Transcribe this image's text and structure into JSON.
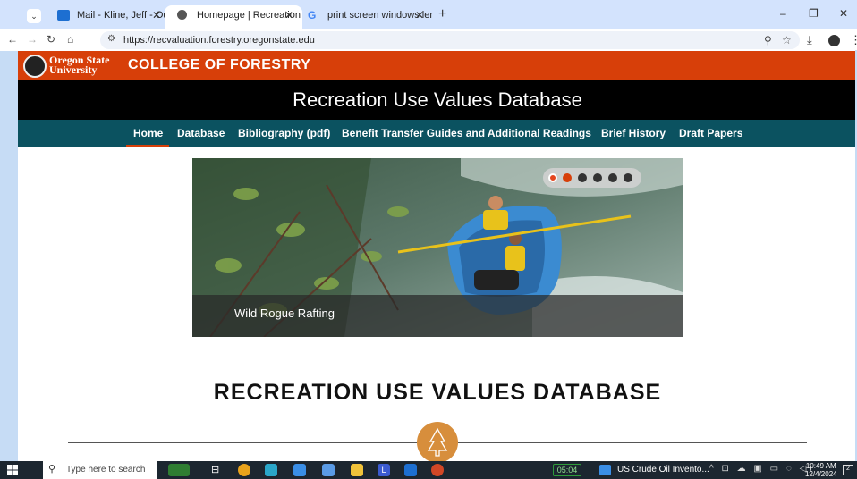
{
  "browser": {
    "tabs": [
      {
        "title": "Mail - Kline, Jeff - Outlook",
        "active": false,
        "favicon_color": "#1d6fd1"
      },
      {
        "title": "Homepage | Recreation Use Val",
        "active": true,
        "favicon_color": "#555555"
      },
      {
        "title": "print screen windows lenovo th",
        "active": false,
        "favicon_color": "#4285f4"
      }
    ],
    "new_tab": "+",
    "url": "https://recvaluation.forestry.oregonstate.edu"
  },
  "site": {
    "university_line1": "Oregon State",
    "university_line2": "University",
    "college": "COLLEGE OF FORESTRY",
    "title": "Recreation Use Values Database",
    "nav": [
      "Home",
      "Database",
      "Bibliography (pdf)",
      "Benefit Transfer Guides and Additional Readings",
      "Brief History",
      "Draft Papers"
    ],
    "active_nav": "Home",
    "slider": {
      "caption": "Wild Rogue Rafting",
      "dot_count": 6,
      "active_dot": 1
    },
    "heading": "RECREATION USE VALUES DATABASE",
    "colors": {
      "osu_orange": "#d73f09",
      "nav_teal": "#0b5260",
      "badge": "#d78e3c"
    }
  },
  "taskbar": {
    "search_placeholder": "Type here to search",
    "timer": "05:04",
    "news": "US Crude Oil Invento...",
    "time": "10:49 AM",
    "date": "12/4/2024",
    "notifications": "2"
  }
}
